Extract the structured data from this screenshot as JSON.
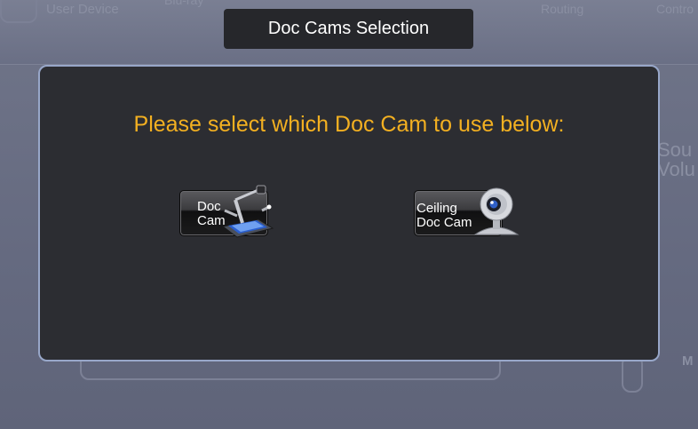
{
  "background": {
    "tabs": [
      "User Device",
      "Blu-ray",
      "Routing",
      "Contro"
    ],
    "side_text": [
      "Sou",
      "Volu"
    ],
    "corner_letter": "M"
  },
  "header": {
    "title": "Doc Cams Selection"
  },
  "modal": {
    "prompt": "Please select which Doc Cam to use below:",
    "buttons": [
      {
        "line1": "Doc",
        "line2": "Cam",
        "icon": "document-camera-icon"
      },
      {
        "line1": "Ceiling",
        "line2": "Doc Cam",
        "icon": "webcam-icon"
      }
    ]
  },
  "colors": {
    "prompt": "#f3b021",
    "modal_bg": "#2c2d32",
    "modal_border": "#98a7c9",
    "title_bg": "#26272b"
  }
}
